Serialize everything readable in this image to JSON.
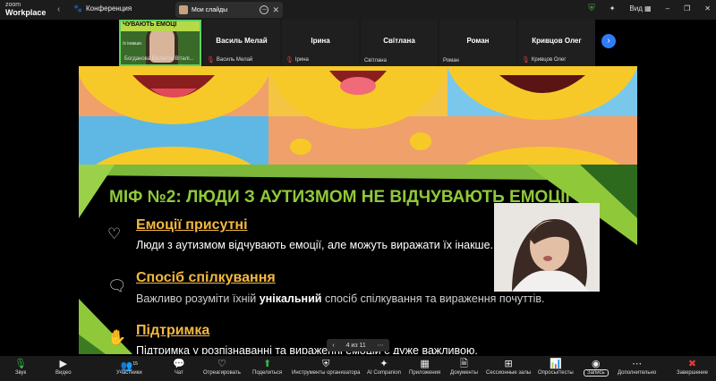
{
  "titlebar": {
    "logo_top": "zoom",
    "logo_bottom": "Workplace",
    "conference_label": "Конференция",
    "slides_tab_label": "Мои слайды",
    "view_label": "Вид"
  },
  "participants": [
    {
      "name": "Богданова Віолетта Віталі...",
      "banner": "ЧУВАЮТЬ ЕМОЦІ",
      "subtext": "їх інакше.",
      "video": true
    },
    {
      "name": "Василь Мелай",
      "muted": true
    },
    {
      "name": "Ірина",
      "muted": true
    },
    {
      "name": "Світлана",
      "muted": false
    },
    {
      "name": "Роман",
      "muted": false
    },
    {
      "name": "Кривцов Олег",
      "muted": true
    }
  ],
  "slide": {
    "title": "МІФ №2: ЛЮДИ З АУТИЗМОМ НЕ ВІДЧУВАЮТЬ ЕМОЦІЇ",
    "items": [
      {
        "heading": "Емоції присутні",
        "text": "Люди з аутизмом відчувають емоції, але можуть виражати їх інакше.",
        "icon": "heart-icon"
      },
      {
        "heading": "Спосіб спілкування",
        "text_before": "Важливо розуміти їхній ",
        "text_bold": "унікальний",
        "text_after": " спосіб спілкування та вираження почуттів.",
        "icon": "chat-icon"
      },
      {
        "heading": "Підтримка",
        "text": "Підтримка у розпізнаванні та вираженні емоцій є дуже важливою.",
        "icon": "hand-icon"
      }
    ],
    "page_indicator": "4 из 11"
  },
  "toolbar": {
    "audio": "Звук",
    "video": "Видео",
    "participants": "Участники",
    "participants_count": "15",
    "chat": "Чат",
    "react": "Отреагировать",
    "share": "Поделиться",
    "host_tools": "Инструменты организатора",
    "ai": "AI Companion",
    "apps": "Приложения",
    "docs": "Документы",
    "breakout": "Сессионные залы",
    "polls": "Опросы/тесты",
    "record": "Запись",
    "more": "Дополнительно",
    "end": "Завершение"
  },
  "colors": {
    "slide_title": "#8fc93a",
    "slide_heading": "#f5b940",
    "active_tile_border": "#5fd35f",
    "end_red": "#e03a3a",
    "share_green": "#2fb84a"
  }
}
